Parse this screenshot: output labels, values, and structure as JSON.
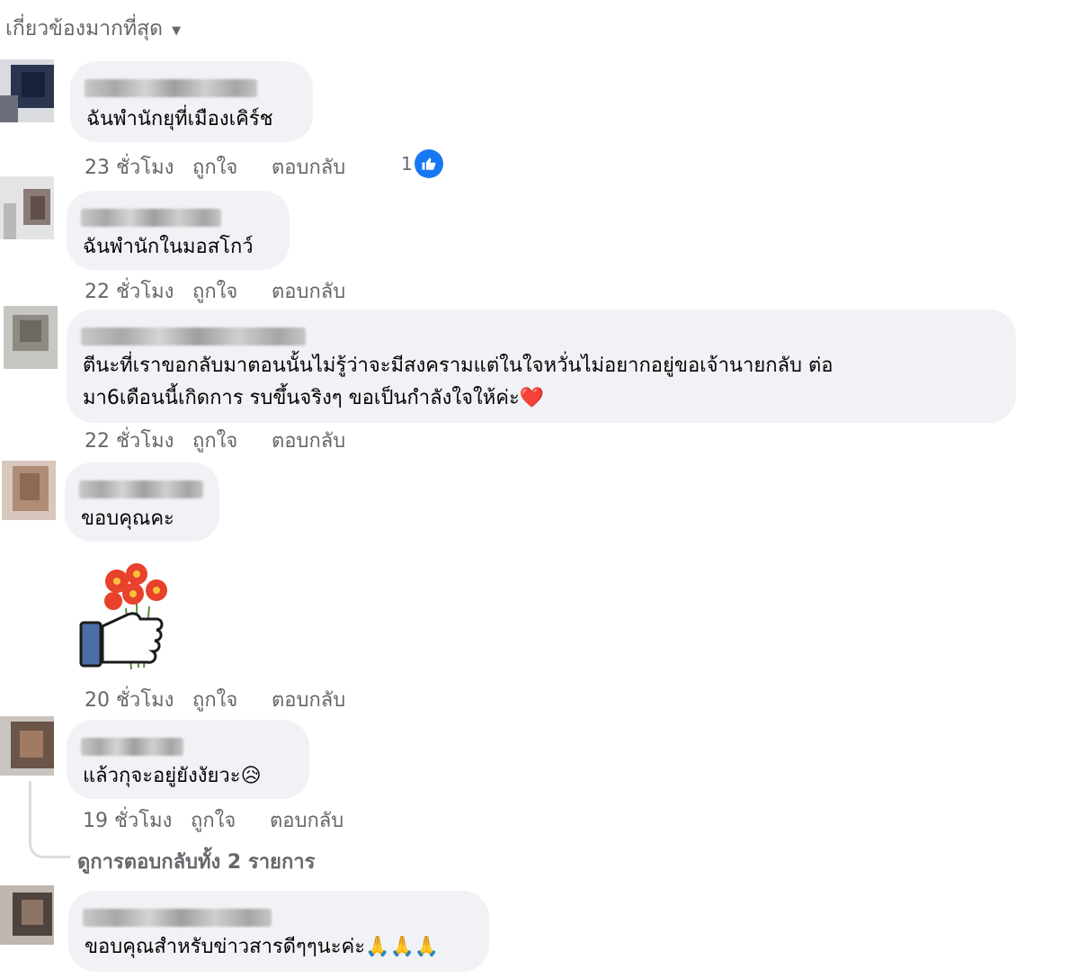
{
  "sort": {
    "label": "เกี่ยวข้องมากที่สุด"
  },
  "comments": [
    {
      "text": "ฉันพำนักยุที่เมืองเคิร์ช",
      "time": "23 ชั่วโมง",
      "like": "ถูกใจ",
      "reply": "ตอบกลับ",
      "reaction_count": "1"
    },
    {
      "text": "ฉันพำนักในมอสโกว์",
      "time": "22 ชั่วโมง",
      "like": "ถูกใจ",
      "reply": "ตอบกลับ"
    },
    {
      "text_line1": "ตีนะที่เราขอกลับมาตอนนั้นไม่รู้ว่าจะมีสงครามแต่ในใจหวั่นไม่อยากอยู่ขอเจ้านายกลับ ต่อ",
      "text_line2": "มา6เดือนนี้เกิดการ รบขึ้นจริงๆ ขอเป็นกำลังใจให้ค่ะ❤️",
      "time": "22 ชั่วโมง",
      "like": "ถูกใจ",
      "reply": "ตอบกลับ"
    },
    {
      "text": "ขอบคุณคะ",
      "time": "20 ชั่วโมง",
      "like": "ถูกใจ",
      "reply": "ตอบกลับ"
    },
    {
      "text": "แล้วกุจะอยู่ยังงัยวะ😥",
      "time": "19 ชั่วโมง",
      "like": "ถูกใจ",
      "reply": "ตอบกลับ",
      "view_replies": "ดูการตอบกลับทั้ง 2 รายการ"
    },
    {
      "text": "ขอบคุณสำหรับข่าวสารดีๆๆนะค่ะ🙏🙏🙏"
    }
  ],
  "colors": {
    "bubble": "#f0f2f5",
    "meta": "#65676b",
    "like_blue": "#1877f2",
    "text": "#050505"
  },
  "icons": {
    "caret": "caret-down-icon",
    "like": "thumbs-up-icon",
    "sticker": "flower-bouquet-sticker"
  }
}
